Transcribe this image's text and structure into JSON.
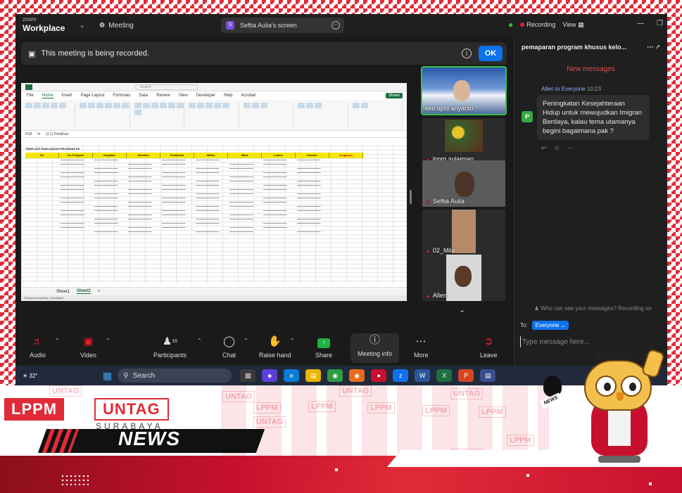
{
  "titlebar": {
    "brand_small": "zoom",
    "brand_large": "Workplace",
    "meeting_menu": "Meeting",
    "screen_share_label": "Seftia Aulia's screen",
    "screen_share_avatar": "S",
    "recording_label": "Recording",
    "view_label": "View"
  },
  "banner": {
    "text": "This meeting is being recorded.",
    "ok_label": "OK"
  },
  "excel": {
    "search_placeholder": "Search",
    "menu": [
      "File",
      "Home",
      "Insert",
      "Page Layout",
      "Formulas",
      "Data",
      "Review",
      "View",
      "Developer",
      "Help",
      "Acrobat"
    ],
    "share_label": "Share",
    "cell_ref": "H18",
    "formula": "(3.1) Pelatihan",
    "sheet_title": "TEMPLATE RANCANGAN PROGRAM KK",
    "columns": [
      "No",
      "Isu Program",
      "Kegiatan",
      "Aktivitas",
      "Pelaksana",
      "Waktu",
      "Mitra",
      "Lokasi",
      "Sumber",
      "Anggaran"
    ],
    "tabs": [
      "Sheet1",
      "Sheet2"
    ],
    "status": "Ready   Accessibility: Investigate"
  },
  "participants": [
    {
      "name": "eko april ariyanto",
      "muted": false,
      "active": true
    },
    {
      "name": "lppm sulaiman",
      "muted": true,
      "active": false
    },
    {
      "name": "Seftia Aulia",
      "muted": true,
      "active": false
    },
    {
      "name": "02_Mila",
      "muted": true,
      "active": false
    },
    {
      "name": "Allen",
      "muted": true,
      "active": false
    }
  ],
  "chat": {
    "header": "pemaparan program khusus kelo...",
    "new_messages": "New messages",
    "sender_avatar": "P",
    "sender_line": "Allen to Everyone",
    "time": "10:23",
    "message": "Peningkatan Kesejahteraan Hidup untuk mewujudkan Imigran Berdaya, kalau tema utamanya begini bagaimana pak ?",
    "who_can_see": "Who can see your messages? Recording on",
    "to_label": "To:",
    "to_value": "Everyone",
    "input_placeholder": "Type message here..."
  },
  "toolbar": {
    "audio": "Audio",
    "video": "Video",
    "participants": "Participants",
    "participants_count": "16",
    "chat": "Chat",
    "raise_hand": "Raise hand",
    "share": "Share",
    "meeting_info": "Meeting info",
    "more": "More",
    "leave": "Leave"
  },
  "taskbar": {
    "temperature": "32°",
    "search_label": "Search"
  },
  "branding": {
    "lppm": "LPPM",
    "untag": "UNTAG",
    "city": "SURABAYA",
    "news": "NEWS",
    "mic_label": "NEWS",
    "stamp_lppm": "LPPM",
    "stamp_untag": "UNTAG"
  },
  "colors": {
    "brand_red": "#e12b38",
    "zoom_blue": "#0e72ed",
    "share_green": "#1fb141",
    "excel_green": "#1d6f42"
  }
}
